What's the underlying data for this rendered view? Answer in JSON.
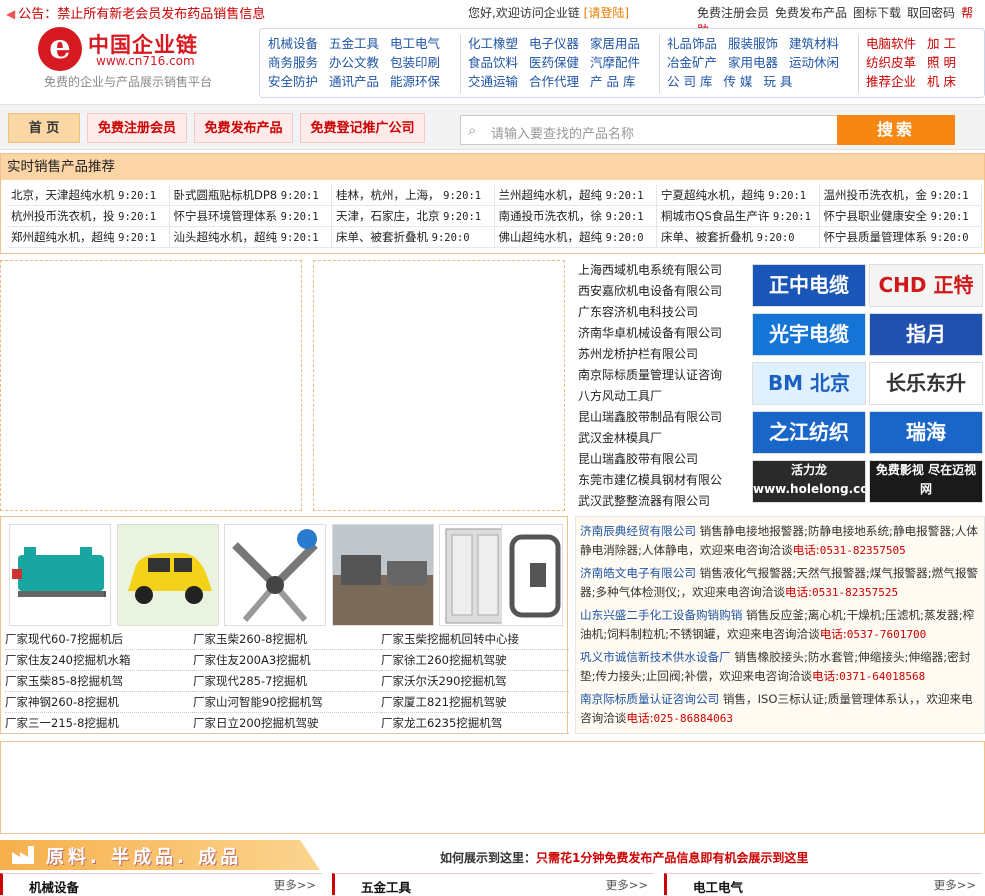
{
  "topbar": {
    "notice_prefix": "公告：",
    "notice_text": "禁止所有新老会员发布药品销售信息",
    "welcome": "您好,欢迎访问企业链",
    "login": "[请登陆]",
    "links": [
      "免费注册会员",
      "免费发布产品",
      "图标下载",
      "取回密码"
    ],
    "help": "帮助"
  },
  "logo": {
    "mark": "e",
    "name": "中国企业链",
    "url": "www.cn716.com",
    "slogan": "免费的企业与产品展示销售平台"
  },
  "categories": {
    "col1": [
      [
        "机械设备",
        "五金工具",
        "电工电气"
      ],
      [
        "商务服务",
        "办公文教",
        "包装印刷"
      ],
      [
        "安全防护",
        "通讯产品",
        "能源环保"
      ]
    ],
    "col2": [
      [
        "化工橡塑",
        "电子仪器",
        "家居用品"
      ],
      [
        "食品饮料",
        "医药保健",
        "汽摩配件"
      ],
      [
        "交通运输",
        "合作代理",
        "产 品 库"
      ]
    ],
    "col3": [
      [
        "礼品饰品",
        "服装服饰",
        "建筑材料"
      ],
      [
        "冶金矿产",
        "家用电器",
        "运动休闲"
      ],
      [
        "公 司 库",
        "传  媒",
        "玩  具"
      ]
    ],
    "col4": [
      [
        "电脑软件",
        "加 工"
      ],
      [
        "纺织皮革",
        "照 明"
      ],
      [
        "推荐企业",
        "机 床"
      ]
    ]
  },
  "nav": {
    "home": "首 页",
    "register": "免费注册会员",
    "publish": "免费发布产品",
    "promote": "免费登记推广公司"
  },
  "search": {
    "placeholder": "请输入要查找的产品名称",
    "button": "搜索"
  },
  "recommend": {
    "title": "实时销售产品推荐",
    "rows": [
      [
        [
          "北京，天津超纯水机",
          "9:20:1"
        ],
        [
          "卧式圆瓶贴标机DP8",
          "9:20:1"
        ],
        [
          "桂林，杭州，上海，",
          "9:20:1"
        ],
        [
          "兰州超纯水机，超纯",
          "9:20:1"
        ],
        [
          "宁夏超纯水机，超纯",
          "9:20:1"
        ],
        [
          "温州投币洗衣机，金",
          "9:20:1"
        ]
      ],
      [
        [
          "杭州投币洗衣机，投",
          "9:20:1"
        ],
        [
          "怀宁县环境管理体系",
          "9:20:1"
        ],
        [
          "天津，石家庄，北京",
          "9:20:1"
        ],
        [
          "南通投币洗衣机，徐",
          "9:20:1"
        ],
        [
          "桐城市QS食品生产许",
          "9:20:1"
        ],
        [
          "怀宁县职业健康安全",
          "9:20:1"
        ]
      ],
      [
        [
          "郑州超纯水机，超纯",
          "9:20:1"
        ],
        [
          "汕头超纯水机，超纯",
          "9:20:1"
        ],
        [
          "床单、被套折叠机",
          "9:20:0"
        ],
        [
          "佛山超纯水机，超纯",
          "9:20:0"
        ],
        [
          "床单、被套折叠机",
          "9:20:0"
        ],
        [
          "怀宁县质量管理体系",
          "9:20:0"
        ]
      ]
    ]
  },
  "companies": [
    "上海西域机电系统有限公司",
    "西安嘉欣机电设备有限公司",
    "广东容济机电科技公司",
    "济南华卓机械设备有限公司",
    "苏州龙桥护栏有限公司",
    "南京际标质量管理认证咨询",
    "八方风动工具厂",
    "昆山瑞鑫胶带制品有限公司",
    "武汉金林模具厂",
    "昆山瑞鑫胶带有限公司",
    "东莞市建亿模具钢材有限公",
    "武汉武整整流器有限公司"
  ],
  "brands": [
    {
      "text": "正中电缆",
      "bg": "#1a56b8",
      "fg": "#fff"
    },
    {
      "text": "CHD 正特",
      "bg": "#f4f4f4",
      "fg": "#d01818"
    },
    {
      "text": "光宇电缆",
      "bg": "#1575d6",
      "fg": "#fff"
    },
    {
      "text": "指月",
      "bg": "#2050b0",
      "fg": "#fff"
    },
    {
      "text": "BM 北京",
      "bg": "#dff0ff",
      "fg": "#1a60c0"
    },
    {
      "text": "长乐东升",
      "bg": "#fff",
      "fg": "#333"
    },
    {
      "text": "之江纺织",
      "bg": "#1a66c8",
      "fg": "#fff"
    },
    {
      "text": "瑞海",
      "bg": "#1a66c8",
      "fg": "#fff"
    },
    {
      "text": "活力龙 www.holelong.com",
      "bg": "#2a2a2a",
      "fg": "#fff"
    },
    {
      "text": "免费影视 尽在迈视网",
      "bg": "#1a1a1a",
      "fg": "#fff"
    }
  ],
  "products": {
    "links": [
      [
        "厂家现代60-7挖掘机后",
        "厂家玉柴260-8挖掘机",
        "厂家玉柴挖掘机回转中心接"
      ],
      [
        "厂家住友240挖掘机水箱",
        "厂家住友200A3挖掘机",
        "厂家徐工260挖掘机驾驶"
      ],
      [
        "厂家玉柴85-8挖掘机驾",
        "厂家现代285-7挖掘机",
        "厂家沃尔沃290挖掘机驾"
      ],
      [
        "厂家神钢260-8挖掘机",
        "厂家山河智能90挖掘机驾",
        "厂家厦工821挖掘机驾驶"
      ],
      [
        "厂家三一215-8挖掘机",
        "厂家日立200挖掘机驾驶",
        "厂家龙工6235挖掘机驾"
      ]
    ]
  },
  "infos": [
    {
      "company": "济南辰典经贸有限公司",
      "text": "销售静电接地报警器;防静电接地系统;静电报警器;人体静电消除器;人体静电，欢迎来电咨询洽谈",
      "tel_label": "电话:",
      "tel": "0531-82357505"
    },
    {
      "company": "济南皓文电子有限公司",
      "text": "销售液化气报警器;天然气报警器;煤气报警器;燃气报警器;多种气体检测仪;，欢迎来电咨询洽谈",
      "tel_label": "电话:",
      "tel": "0531-82357525"
    },
    {
      "company": "山东兴盛二手化工设备购销购销",
      "text": "销售反应釜;离心机;干燥机;压滤机;蒸发器;榨油机;饲料制粒机;不锈钢罐，欢迎来电咨询洽谈",
      "tel_label": "电话:",
      "tel": "0537-7601700"
    },
    {
      "company": "巩义市诚信新技术供水设备厂",
      "text": "销售橡胶接头;防水套管;伸缩接头;伸缩器;密封垫;传力接头;止回阀;补偿，欢迎来电咨询洽谈",
      "tel_label": "电话:",
      "tel": "0371-64018568"
    },
    {
      "company": "南京际标质量认证咨询公司",
      "text": "销售，ISO三标认证;质量管理体系认，，欢迎来电咨询洽谈",
      "tel_label": "电话:",
      "tel": "025-86884063"
    }
  ],
  "section": {
    "title": "原料. 半成品. 成品",
    "prompt": "如何展示到这里：",
    "prompt_hl": "只需花1分钟免费发布产品信息即有机会展示到这里"
  },
  "panels": [
    {
      "name": "机械设备",
      "more": "更多>>"
    },
    {
      "name": "五金工具",
      "more": "更多>>"
    },
    {
      "name": "电工电气",
      "more": "更多>>"
    }
  ]
}
